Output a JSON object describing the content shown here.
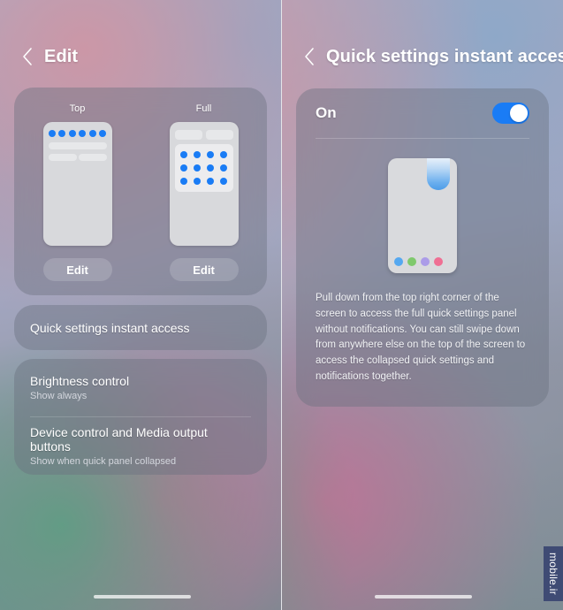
{
  "left_panel": {
    "header": {
      "back_icon": "chevron-left-icon",
      "title": "Edit"
    },
    "preview_card": {
      "options": [
        {
          "label": "Top",
          "variant": "top",
          "edit_label": "Edit",
          "dot_count": 6,
          "dot_color": "#1a7cf5"
        },
        {
          "label": "Full",
          "variant": "full",
          "edit_label": "Edit",
          "grid_columns": 4,
          "grid_rows": 3,
          "dot_color": "#1a7cf5"
        }
      ]
    },
    "rows": [
      {
        "title": "Quick settings instant access",
        "subtitle": ""
      },
      {
        "title": "Brightness control",
        "subtitle": "Show always"
      },
      {
        "title": "Device control and Media output buttons",
        "subtitle": "Show when quick panel collapsed"
      }
    ]
  },
  "right_panel": {
    "header": {
      "back_icon": "chevron-left-icon",
      "title": "Quick settings instant access"
    },
    "toggle": {
      "label": "On",
      "state": "on",
      "accent": "#1a7cf5"
    },
    "illustration": {
      "name": "pull-down-corner-illustration",
      "pull_shape_color": "#4d9ce8",
      "dots": [
        "#55a8f0",
        "#7fc96d",
        "#ab9ce8",
        "#ef6f93"
      ]
    },
    "description": "Pull down from the top right corner of the screen to access the full quick settings panel without notifications. You can still swipe down from anywhere else on the top of the screen to access the collapsed quick settings and notifications together."
  },
  "watermark": {
    "text": "mobile.ir"
  }
}
